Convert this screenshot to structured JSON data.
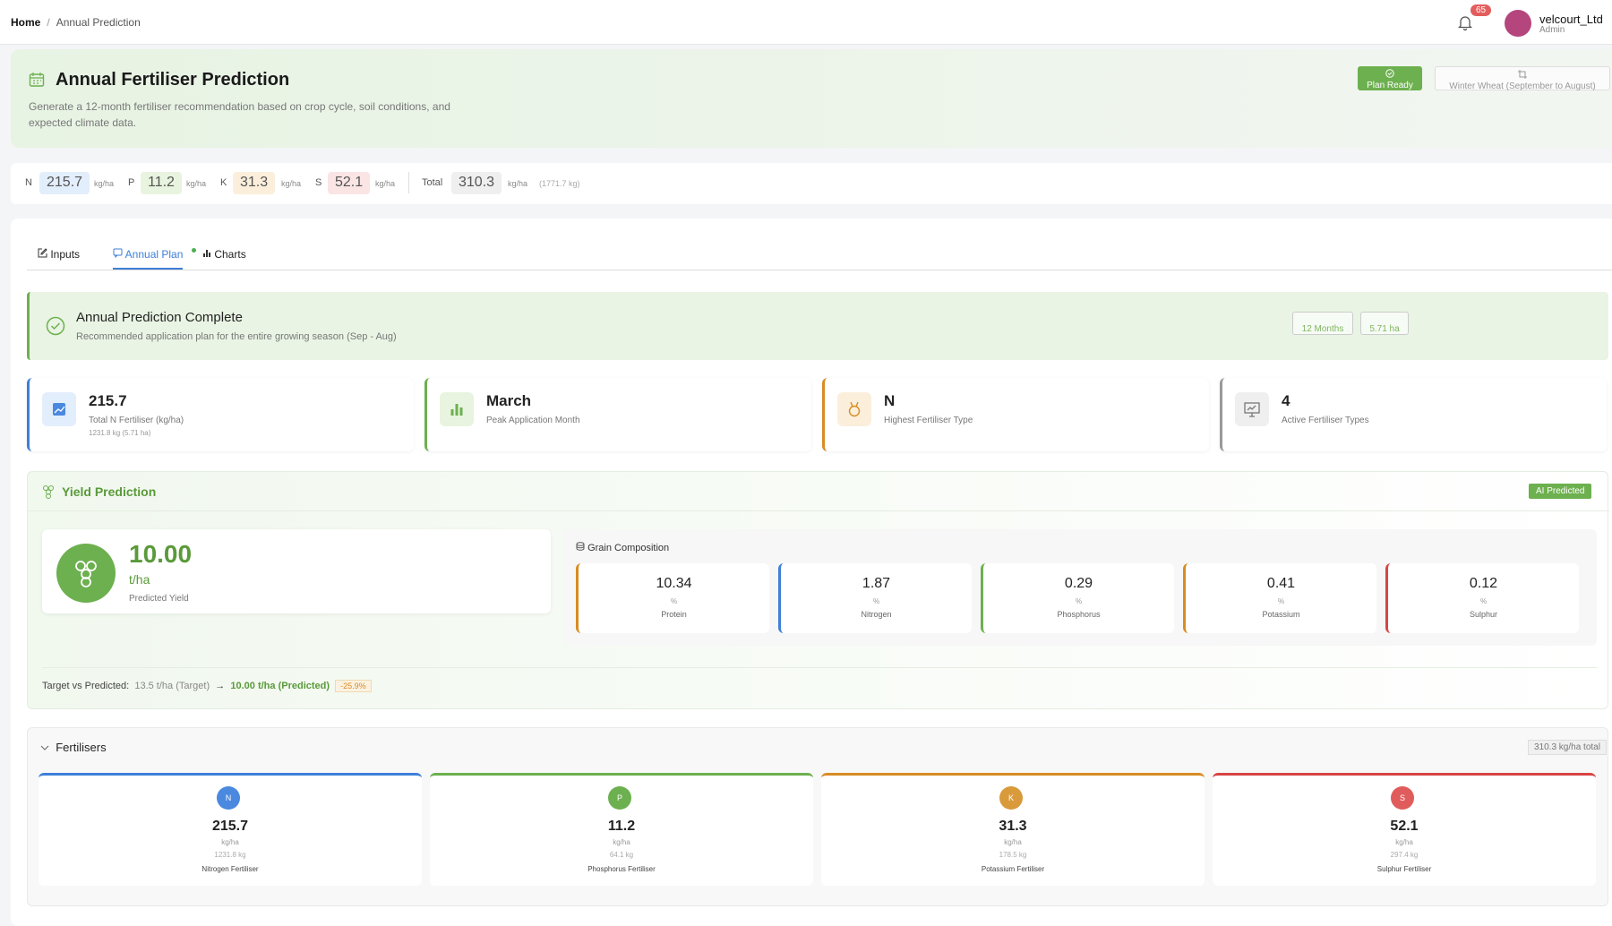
{
  "breadcrumb": {
    "home": "Home",
    "sep": "/",
    "current": "Annual Prediction"
  },
  "user": {
    "name": "velcourt_Ltd",
    "role": "Admin",
    "notifications": "65"
  },
  "hero": {
    "title": "Annual Fertiliser Prediction",
    "description": "Generate a 12-month fertiliser recommendation based on crop cycle, soil conditions, and expected climate data.",
    "status_label": "Plan Ready",
    "crop_label": "Winter Wheat (September to August)"
  },
  "nutrients": {
    "n_label": "N",
    "n_value": "215.7",
    "p_label": "P",
    "p_value": "11.2",
    "k_label": "K",
    "k_value": "31.3",
    "s_label": "S",
    "s_value": "52.1",
    "unit": "kg/ha",
    "total_label": "Total",
    "total_value": "310.3",
    "total_kg": "(1771.7 kg)"
  },
  "tabs": [
    {
      "label": "Inputs"
    },
    {
      "label": "Annual Plan"
    },
    {
      "label": "Charts"
    }
  ],
  "complete": {
    "title": "Annual Prediction Complete",
    "subtitle": "Recommended application plan for the entire growing season (Sep - Aug)",
    "months": "12 Months",
    "area": "5.71 ha"
  },
  "kpis": [
    {
      "value": "215.7",
      "label": "Total N Fertiliser (kg/ha)",
      "sub": "1231.8 kg (5.71 ha)"
    },
    {
      "value": "March",
      "label": "Peak Application Month"
    },
    {
      "value": "N",
      "label": "Highest Fertiliser Type"
    },
    {
      "value": "4",
      "label": "Active Fertiliser Types"
    }
  ],
  "yield": {
    "title": "Yield Prediction",
    "badge": "AI Predicted",
    "value": "10.00",
    "unit": "t/ha",
    "label": "Predicted Yield",
    "grain_title": "Grain Composition",
    "grain": [
      {
        "value": "10.34",
        "unit": "%",
        "label": "Protein"
      },
      {
        "value": "1.87",
        "unit": "%",
        "label": "Nitrogen"
      },
      {
        "value": "0.29",
        "unit": "%",
        "label": "Phosphorus"
      },
      {
        "value": "0.41",
        "unit": "%",
        "label": "Potassium"
      },
      {
        "value": "0.12",
        "unit": "%",
        "label": "Sulphur"
      }
    ],
    "target_label": "Target vs Predicted:",
    "target": "13.5 t/ha (Target)",
    "arrow": "→",
    "predicted": "10.00 t/ha (Predicted)",
    "diff": "-25.9%"
  },
  "fertilisers": {
    "title": "Fertilisers",
    "total": "310.3 kg/ha total",
    "items": [
      {
        "symbol": "N",
        "value": "215.7",
        "unit": "kg/ha",
        "kg": "1231.8 kg",
        "name": "Nitrogen Fertiliser"
      },
      {
        "symbol": "P",
        "value": "11.2",
        "unit": "kg/ha",
        "kg": "64.1 kg",
        "name": "Phosphorus Fertiliser"
      },
      {
        "symbol": "K",
        "value": "31.3",
        "unit": "kg/ha",
        "kg": "178.5 kg",
        "name": "Potassium Fertiliser"
      },
      {
        "symbol": "S",
        "value": "52.1",
        "unit": "kg/ha",
        "kg": "297.4 kg",
        "name": "Sulphur Fertiliser"
      }
    ]
  },
  "colors": {
    "n": "#3f7fd8",
    "p": "#6db04f",
    "k": "#d88c23",
    "s": "#d84444",
    "accent": "#6db04f"
  }
}
